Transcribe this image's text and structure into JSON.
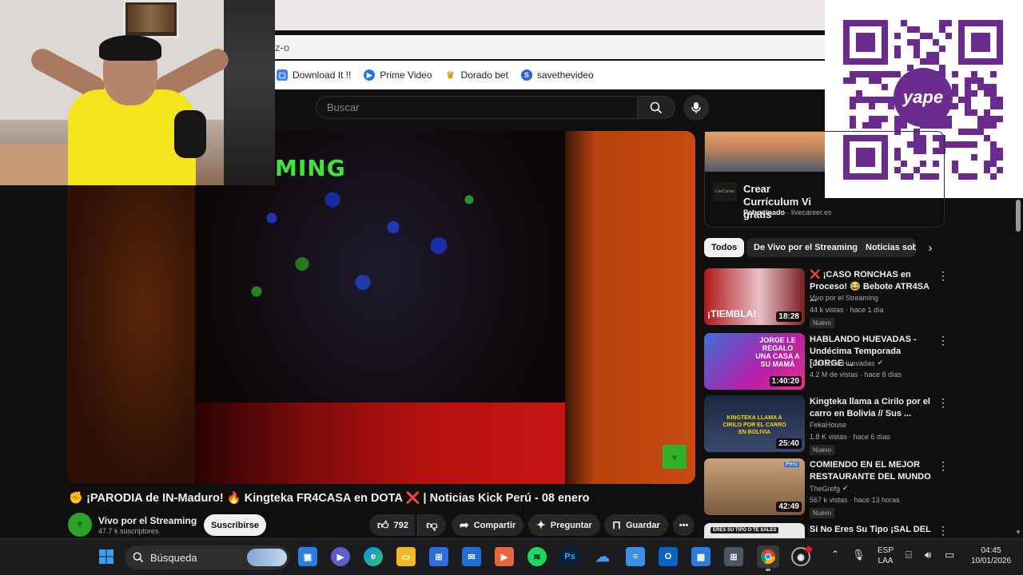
{
  "browser": {
    "address_fragment": "z-o",
    "bookmarks": [
      {
        "label": "Download It !!",
        "icon": "folder-icon",
        "color": "#3b82f6"
      },
      {
        "label": "Prime Video",
        "icon": "play-icon",
        "color": "#1a73e8"
      },
      {
        "label": "Dorado bet",
        "icon": "star-icon",
        "color": "#d4a017"
      },
      {
        "label": "savethevideo",
        "icon": "s-icon",
        "color": "#2563eb"
      }
    ]
  },
  "youtube": {
    "search_placeholder": "Buscar",
    "video_overlay_text": "MING",
    "video_title": "✊ ¡PARODIA de IN-Maduro! 🔥 Kingteka FR4CASA en DOTA ❌ | Noticias Kick Perú - 08 enero",
    "channel": {
      "name": "Vivo por el Streaming",
      "subscribers": "47.7 k suscriptores",
      "subscribe_label": "Suscribirse"
    },
    "actions": {
      "likes": "792",
      "share": "Compartir",
      "ask": "Preguntar",
      "save": "Guardar"
    }
  },
  "ad": {
    "title": "Crear Currículum Vi\ngratis",
    "sponsor_label": "Patrocinado",
    "sponsor_domain": "livecareer.es",
    "icon_text": "LiveCareer"
  },
  "chips": [
    "Todos",
    "De Vivo por el Streaming",
    "Noticias sob"
  ],
  "recommendations": [
    {
      "title_prefix": "❌",
      "title": "¡CASO RONCHAS en Proceso! 😂 Bebote ATR4SA ...",
      "channel": "Vivo por el Streaming",
      "verified": false,
      "meta": "44 k vistas · hace 1 día",
      "badge": "Nuevo",
      "duration": "18:28",
      "thumb_text": "¡TIEMBLA!",
      "thumb_colors": [
        "#b01818",
        "#e8c0c8"
      ]
    },
    {
      "title_prefix": "",
      "title": "HABLANDO HUEVADAS - Undécima Temporada [JORGE ...",
      "channel": "Hablando Huevadas",
      "verified": true,
      "meta": "4.2 M de vistas · hace 8 días",
      "badge": "",
      "duration": "1:40:20",
      "thumb_text": "JORGE LE REGALO UNA CASA A SU MAMÁ",
      "thumb_colors": [
        "#b51fa8",
        "#3b6fd8"
      ]
    },
    {
      "title_prefix": "",
      "title": "Kingteka llama a Cirilo por el carro en Bolivia // Sus ...",
      "channel": "FekaHouse",
      "verified": false,
      "meta": "1.8 K vistas · hace 6 días",
      "badge": "Nuevo",
      "duration": "25:40",
      "thumb_text": "KINGTEKA LLAMA A CIRILO POR EL CARRO EN BOLIVIA",
      "thumb_colors": [
        "#1c2640",
        "#3a4a6e"
      ]
    },
    {
      "title_prefix": "",
      "title": "COMIENDO EN EL MEJOR RESTAURANTE DEL MUNDO",
      "channel": "TheGrefg",
      "verified": true,
      "meta": "567 k vistas · hace 13 horas",
      "badge": "Nuevo",
      "duration": "42:49",
      "thumb_text": "Perú",
      "thumb_colors": [
        "#7a5a3e",
        "#c9a27a"
      ]
    },
    {
      "title_prefix": "",
      "title": "Si No Eres Su Tipo ¡SAL DEL",
      "channel": "",
      "verified": false,
      "meta": "",
      "badge": "",
      "duration": "",
      "thumb_text": "ERES SU TIPO O TE SALES",
      "thumb_colors": [
        "#e8e8e8",
        "#c8c8c8"
      ]
    }
  ],
  "qr": {
    "brand": "yape",
    "brand_color": "#6c2b8f"
  },
  "taskbar": {
    "search_placeholder": "Búsqueda",
    "language": "ESP",
    "keyboard": "LAA",
    "time": "04:45",
    "date": "10/01/2026"
  }
}
